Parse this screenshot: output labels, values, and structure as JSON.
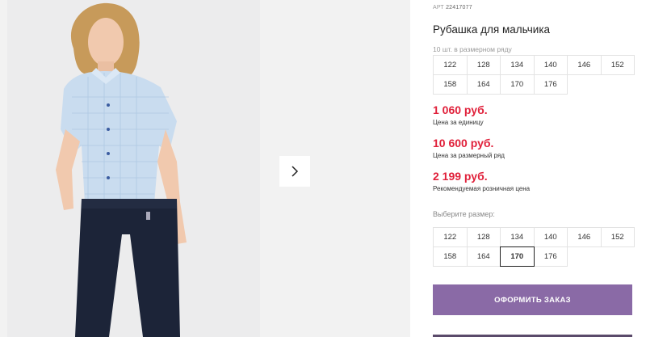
{
  "product": {
    "art_label": "АРТ",
    "art_number": "22417077",
    "title": "Рубашка для мальчика",
    "row_note": "10 шт. в размерном ряду",
    "size_row": [
      "122",
      "128",
      "134",
      "140",
      "146",
      "152",
      "158",
      "164",
      "170",
      "176"
    ]
  },
  "prices": [
    {
      "value": "1 060 руб.",
      "label": "Цена за единицу"
    },
    {
      "value": "10 600 руб.",
      "label": "Цена за размерный ряд"
    },
    {
      "value": "2 199 руб.",
      "label": "Рекомендуемая розничная цена"
    }
  ],
  "size_select": {
    "label": "Выберите размер:",
    "options": [
      "122",
      "128",
      "134",
      "140",
      "146",
      "152",
      "158",
      "164",
      "170",
      "176"
    ],
    "selected": "170"
  },
  "order_button": "ОФОРМИТЬ ЗАКАЗ",
  "colors": {
    "price": "#e0203a",
    "order_button": "#8a6aa6",
    "shirt": "#c9dcef",
    "trousers": "#1c2438"
  },
  "icons": {
    "next": "chevron-right-icon"
  }
}
